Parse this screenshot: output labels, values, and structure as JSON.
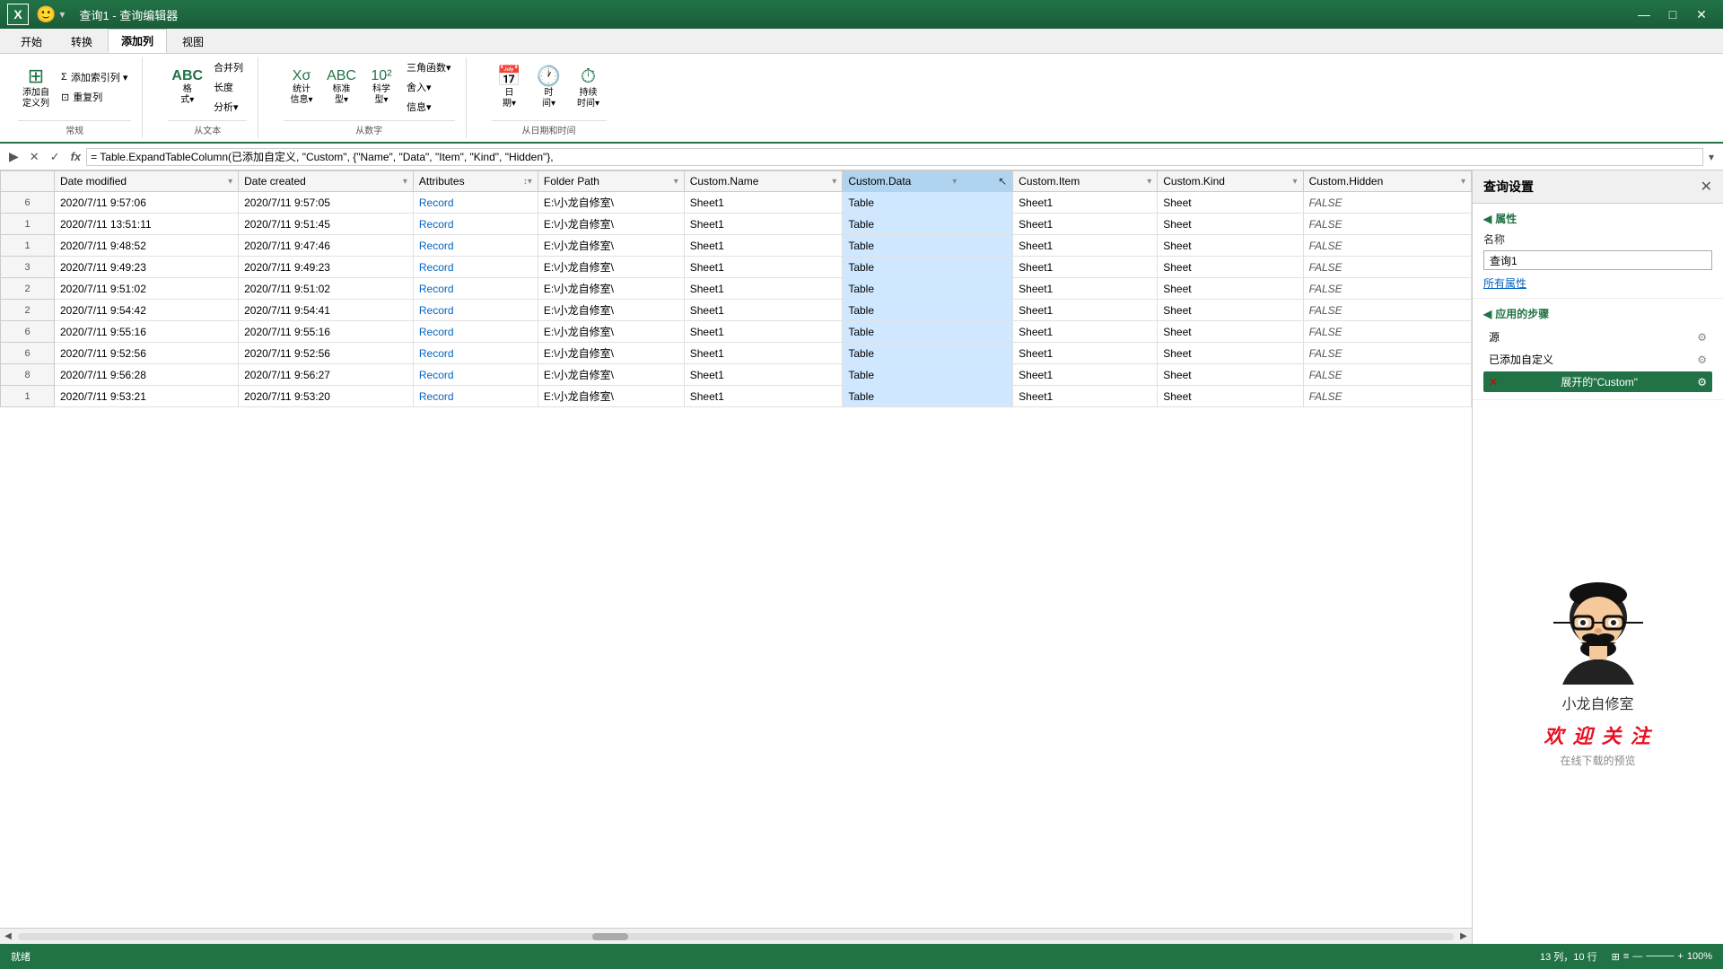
{
  "titlebar": {
    "icon": "X",
    "title": "查询1 - 查询编辑器",
    "btn_min": "—",
    "btn_max": "□",
    "btn_close": "✕"
  },
  "ribbon": {
    "tabs": [
      "开始",
      "转换",
      "添加列",
      "视图"
    ],
    "active_tab": "添加列",
    "groups": [
      {
        "label": "常规",
        "items": [
          {
            "icon": "⊞",
            "label": "添加自\n定义列"
          },
          {
            "small": true,
            "items": [
              {
                "icon": "Σ",
                "label": "添加索引列 ▾"
              },
              {
                "icon": "⊡",
                "label": "重复列"
              }
            ]
          }
        ]
      },
      {
        "label": "从文本",
        "items": [
          {
            "icon": "ABC",
            "label": "格\n式▾"
          },
          {
            "small": true,
            "items": [
              {
                "label": "合并列"
              },
              {
                "label": "长度"
              },
              {
                "label": "分析▾"
              }
            ]
          }
        ]
      },
      {
        "label": "从数字",
        "items": [
          {
            "icon": "Xσ",
            "label": "统计\n信息▾"
          },
          {
            "icon": "ABC",
            "label": "标准\n型▾"
          },
          {
            "icon": "10²",
            "label": "科学\n型▾"
          },
          {
            "small": true,
            "items": [
              {
                "label": "三角函数▾"
              },
              {
                "label": "舍入▾"
              },
              {
                "label": "信息▾"
              }
            ]
          }
        ]
      },
      {
        "label": "从日期和时间",
        "items": [
          {
            "icon": "📅",
            "label": "日\n期▾"
          },
          {
            "icon": "🕐",
            "label": "时\n间▾"
          },
          {
            "icon": "⏱",
            "label": "持续\n时间▾"
          }
        ]
      }
    ]
  },
  "formula_bar": {
    "nav_arrow": "▶",
    "cancel": "✕",
    "confirm": "✓",
    "fx": "fx",
    "formula": "= Table.ExpandTableColumn(已添加自定义, \"Custom\", {\"Name\", \"Data\", \"Item\", \"Kind\", \"Hidden\"},",
    "expand": "▾"
  },
  "table": {
    "columns": [
      {
        "id": "row_num",
        "label": "",
        "sortable": false
      },
      {
        "id": "date_modified",
        "label": "Date modified",
        "sortable": true
      },
      {
        "id": "date_created",
        "label": "Date created",
        "sortable": true
      },
      {
        "id": "attributes",
        "label": "Attributes",
        "sortable": true
      },
      {
        "id": "folder_path",
        "label": "Folder Path",
        "sortable": true
      },
      {
        "id": "custom_name",
        "label": "Custom.Name",
        "sortable": true
      },
      {
        "id": "custom_data",
        "label": "Custom.Data",
        "sortable": true,
        "highlight": true
      },
      {
        "id": "custom_item",
        "label": "Custom.Item",
        "sortable": true
      },
      {
        "id": "custom_kind",
        "label": "Custom.Kind",
        "sortable": true
      },
      {
        "id": "custom_hidden",
        "label": "Custom.Hidden",
        "sortable": true
      }
    ],
    "rows": [
      {
        "row_num": "6",
        "date_modified": "2020/7/11 9:57:06",
        "date_created": "2020/7/11 9:57:05",
        "attributes": "Record",
        "folder_path": "E:\\小龙自修室\\",
        "custom_name": "Sheet1",
        "custom_data": "Table",
        "custom_item": "Sheet1",
        "custom_kind": "Sheet",
        "custom_hidden": "FALSE"
      },
      {
        "row_num": "1",
        "date_modified": "2020/7/11 13:51:11",
        "date_created": "2020/7/11 9:51:45",
        "attributes": "Record",
        "folder_path": "E:\\小龙自修室\\",
        "custom_name": "Sheet1",
        "custom_data": "Table",
        "custom_item": "Sheet1",
        "custom_kind": "Sheet",
        "custom_hidden": "FALSE"
      },
      {
        "row_num": "1",
        "date_modified": "2020/7/11 9:48:52",
        "date_created": "2020/7/11 9:47:46",
        "attributes": "Record",
        "folder_path": "E:\\小龙自修室\\",
        "custom_name": "Sheet1",
        "custom_data": "Table",
        "custom_item": "Sheet1",
        "custom_kind": "Sheet",
        "custom_hidden": "FALSE"
      },
      {
        "row_num": "3",
        "date_modified": "2020/7/11 9:49:23",
        "date_created": "2020/7/11 9:49:23",
        "attributes": "Record",
        "folder_path": "E:\\小龙自修室\\",
        "custom_name": "Sheet1",
        "custom_data": "Table",
        "custom_item": "Sheet1",
        "custom_kind": "Sheet",
        "custom_hidden": "FALSE"
      },
      {
        "row_num": "2",
        "date_modified": "2020/7/11 9:51:02",
        "date_created": "2020/7/11 9:51:02",
        "attributes": "Record",
        "folder_path": "E:\\小龙自修室\\",
        "custom_name": "Sheet1",
        "custom_data": "Table",
        "custom_item": "Sheet1",
        "custom_kind": "Sheet",
        "custom_hidden": "FALSE"
      },
      {
        "row_num": "2",
        "date_modified": "2020/7/11 9:54:42",
        "date_created": "2020/7/11 9:54:41",
        "attributes": "Record",
        "folder_path": "E:\\小龙自修室\\",
        "custom_name": "Sheet1",
        "custom_data": "Table",
        "custom_item": "Sheet1",
        "custom_kind": "Sheet",
        "custom_hidden": "FALSE"
      },
      {
        "row_num": "6",
        "date_modified": "2020/7/11 9:55:16",
        "date_created": "2020/7/11 9:55:16",
        "attributes": "Record",
        "folder_path": "E:\\小龙自修室\\",
        "custom_name": "Sheet1",
        "custom_data": "Table",
        "custom_item": "Sheet1",
        "custom_kind": "Sheet",
        "custom_hidden": "FALSE"
      },
      {
        "row_num": "6",
        "date_modified": "2020/7/11 9:52:56",
        "date_created": "2020/7/11 9:52:56",
        "attributes": "Record",
        "folder_path": "E:\\小龙自修室\\",
        "custom_name": "Sheet1",
        "custom_data": "Table",
        "custom_item": "Sheet1",
        "custom_kind": "Sheet",
        "custom_hidden": "FALSE"
      },
      {
        "row_num": "8",
        "date_modified": "2020/7/11 9:56:28",
        "date_created": "2020/7/11 9:56:27",
        "attributes": "Record",
        "folder_path": "E:\\小龙自修室\\",
        "custom_name": "Sheet1",
        "custom_data": "Table",
        "custom_item": "Sheet1",
        "custom_kind": "Sheet",
        "custom_hidden": "FALSE"
      },
      {
        "row_num": "1",
        "date_modified": "2020/7/11 9:53:21",
        "date_created": "2020/7/11 9:53:20",
        "attributes": "Record",
        "folder_path": "E:\\小龙自修室\\",
        "custom_name": "Sheet1",
        "custom_data": "Table",
        "custom_item": "Sheet1",
        "custom_kind": "Sheet",
        "custom_hidden": "FALSE"
      }
    ]
  },
  "right_panel": {
    "title": "查询设置",
    "close_btn": "✕",
    "properties_label": "属性",
    "name_label": "名称",
    "query_name": "查询1",
    "all_props_link": "所有属性",
    "steps_label": "应用的步骤",
    "steps": [
      {
        "name": "源",
        "active": false,
        "gear": true,
        "error": false
      },
      {
        "name": "已添加自定义",
        "active": false,
        "gear": true,
        "error": false
      },
      {
        "name": "展开的\"Custom\"",
        "active": true,
        "gear": true,
        "error": true
      }
    ],
    "avatar_name": "小龙自修室",
    "welcome_text": "欢 迎 关 注",
    "welcome_sub": "在线下载的预览"
  },
  "status_bar": {
    "left": "就绪",
    "info": "13 列，10 行",
    "zoom": "100%"
  }
}
